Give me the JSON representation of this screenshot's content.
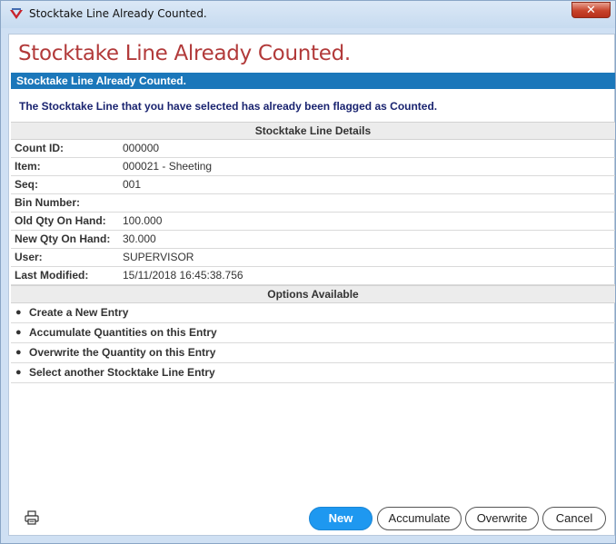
{
  "window": {
    "title": "Stocktake Line Already Counted.",
    "close_label": "✕"
  },
  "dialog": {
    "heading": "Stocktake Line Already Counted.",
    "banner": "Stocktake Line Already Counted.",
    "message": "The Stocktake Line that you have selected has already been flagged as Counted."
  },
  "details": {
    "header": "Stocktake Line Details",
    "rows": [
      {
        "label": "Count ID:",
        "value": "000000"
      },
      {
        "label": "Item:",
        "value": "000021 - Sheeting"
      },
      {
        "label": "Seq:",
        "value": "001"
      },
      {
        "label": "Bin Number:",
        "value": ""
      },
      {
        "label": "Old Qty On Hand:",
        "value": "100.000"
      },
      {
        "label": "New Qty On Hand:",
        "value": "30.000"
      },
      {
        "label": "User:",
        "value": "SUPERVISOR"
      },
      {
        "label": "Last Modified:",
        "value": "15/11/2018 16:45:38.756"
      }
    ]
  },
  "options": {
    "header": "Options Available",
    "bullet": "●",
    "items": [
      "Create a New Entry",
      "Accumulate Quantities on this Entry",
      "Overwrite the Quantity on this Entry",
      "Select another Stocktake Line Entry"
    ]
  },
  "buttons": {
    "new": "New",
    "accumulate": "Accumulate",
    "overwrite": "Overwrite",
    "cancel": "Cancel"
  },
  "icons": {
    "app": "app-logo-icon",
    "print": "printer-icon"
  },
  "colors": {
    "heading": "#b23a3a",
    "banner": "#1b77ba",
    "primary_button": "#1e98f0",
    "message": "#1a2470"
  }
}
